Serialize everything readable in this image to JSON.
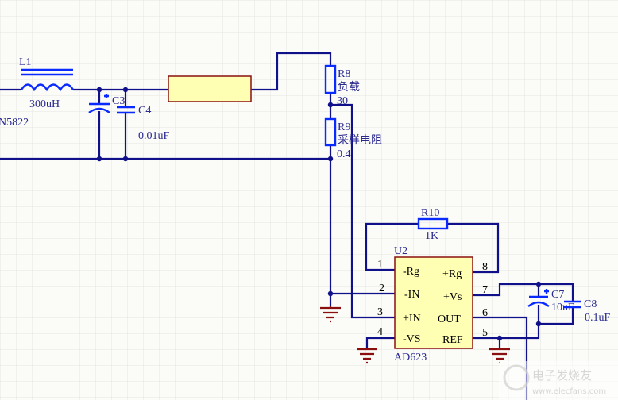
{
  "components": {
    "L1": {
      "ref": "L1",
      "value": "300uH"
    },
    "D": {
      "value_partial": "N5822"
    },
    "C3": {
      "ref": "C3"
    },
    "C4": {
      "ref": "C4",
      "value": "0.01uF"
    },
    "R8": {
      "ref": "R8",
      "name": "负载",
      "value": "30"
    },
    "R9": {
      "ref": "R9",
      "name": "采样电阻",
      "value": "0.4"
    },
    "R10": {
      "ref": "R10",
      "value": "1K"
    },
    "U2": {
      "ref": "U2",
      "part": "AD623",
      "left_pins": [
        {
          "num": "1",
          "label": "-Rg"
        },
        {
          "num": "2",
          "label": "-IN"
        },
        {
          "num": "3",
          "label": "+IN"
        },
        {
          "num": "4",
          "label": "-VS"
        }
      ],
      "right_pins": [
        {
          "num": "8",
          "label": "+Rg"
        },
        {
          "num": "7",
          "label": "+Vs"
        },
        {
          "num": "6",
          "label": "OUT"
        },
        {
          "num": "5",
          "label": "REF"
        }
      ]
    },
    "C7": {
      "ref": "C7",
      "value": "10uF"
    },
    "C8": {
      "ref": "C8",
      "value": "0.1uF"
    }
  },
  "watermark": {
    "name": "电子发烧友",
    "url": "www.elecfans.com"
  },
  "colors": {
    "wire": "#10108a",
    "component": "#0a2bff",
    "ground": "#8a1010",
    "ic_fill": "#ffffb4",
    "ic_border": "#8a1010"
  }
}
